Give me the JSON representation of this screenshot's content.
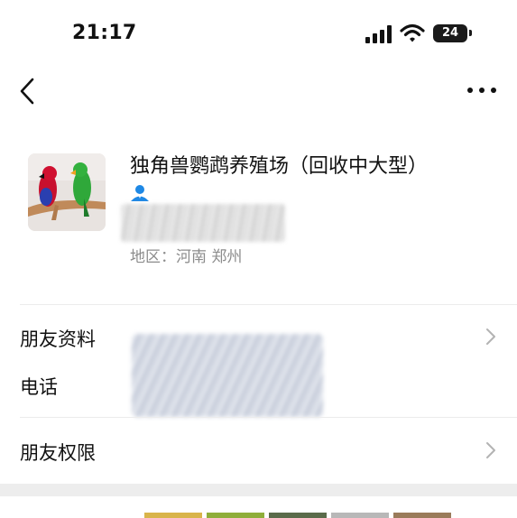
{
  "status_bar": {
    "time": "21:17",
    "battery": "24"
  },
  "header": {
    "back_icon": "chevron-left-icon",
    "more_icon": "ellipsis-icon"
  },
  "contact": {
    "name": "独角兽鹦鹉养殖场（回收中大型）",
    "region": "地区：河南 郑州",
    "verify_icon": "person-icon",
    "accent_color": "#1e88e5"
  },
  "rows": [
    {
      "label": "朋友资料",
      "chevron": true
    },
    {
      "label": "电话",
      "chevron": false
    },
    {
      "label": "朋友权限",
      "chevron": true
    }
  ]
}
